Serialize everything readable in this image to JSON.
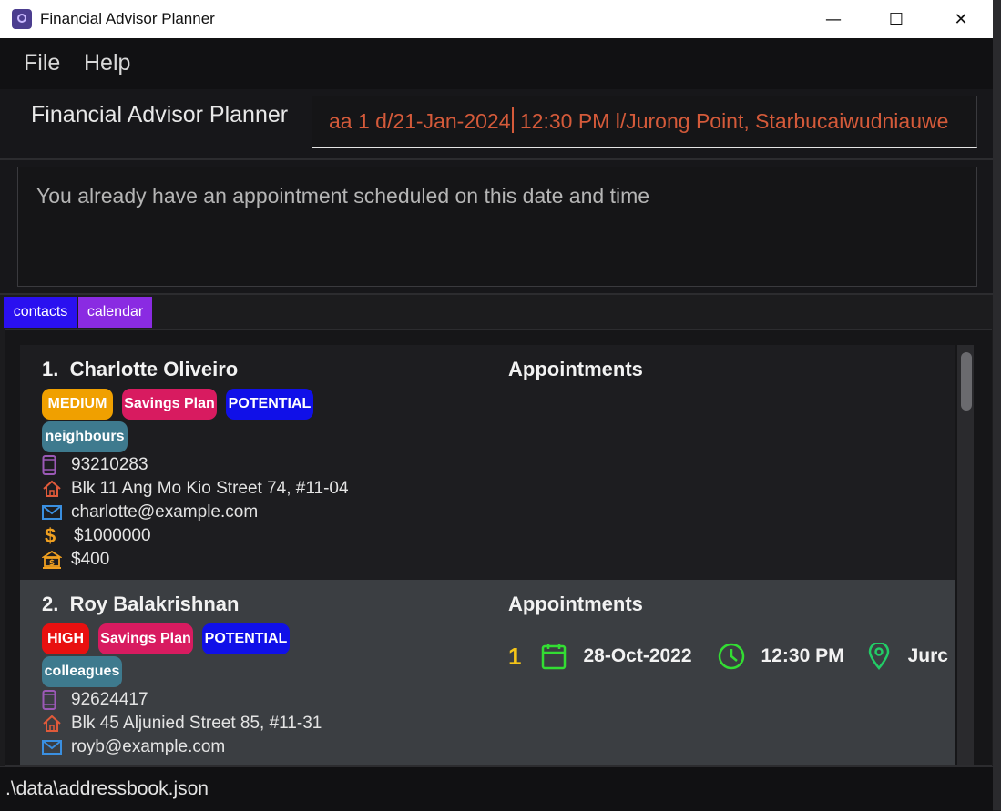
{
  "window": {
    "title": "Financial Advisor Planner",
    "minimize_glyph": "—",
    "maximize_glyph": "☐",
    "close_glyph": "✕"
  },
  "menu": {
    "items": [
      "File",
      "Help"
    ]
  },
  "command": {
    "app_label": "Financial Advisor Planner",
    "text_before_caret": "aa 1 d/21-Jan-2024",
    "text_after_caret": " 12:30 PM l/Jurong Point, Starbucaiwudniauwe"
  },
  "result": {
    "message": "You already have an appointment scheduled on this date and time"
  },
  "tabs": [
    {
      "label": "contacts",
      "color": "#2a10f0"
    },
    {
      "label": "calendar",
      "color": "#8a2be2"
    }
  ],
  "contacts": [
    {
      "index": "1.",
      "name": "Charlotte Oliveiro",
      "tags": [
        {
          "label": "MEDIUM",
          "color": "#f0a000"
        },
        {
          "label": "Savings Plan",
          "color": "#d81b60"
        },
        {
          "label": "POTENTIAL",
          "color": "#1010e8"
        },
        {
          "label": "neighbours",
          "color": "#3e7a8e"
        }
      ],
      "phone": "93210283",
      "address": "Blk 11 Ang Mo Kio Street 74, #11-04",
      "email": "charlotte@example.com",
      "income": "$1000000",
      "monthly": "$400",
      "appointments_heading": "Appointments",
      "appointments": []
    },
    {
      "index": "2.",
      "name": "Roy Balakrishnan",
      "tags": [
        {
          "label": "HIGH",
          "color": "#e81010"
        },
        {
          "label": "Savings Plan",
          "color": "#d81b60"
        },
        {
          "label": "POTENTIAL",
          "color": "#1010e8"
        },
        {
          "label": "colleagues",
          "color": "#3e7a8e"
        }
      ],
      "phone": "92624417",
      "address": "Blk 45 Aljunied Street 85, #11-31",
      "email": "royb@example.com",
      "appointments_heading": "Appointments",
      "appointments": [
        {
          "index": "1",
          "date": "28-Oct-2022",
          "time": "12:30 PM",
          "location": "Jurc"
        }
      ]
    }
  ],
  "status": {
    "path": ".\\data\\addressbook.json"
  },
  "icons": {
    "phone": "phone-icon",
    "address": "home-icon",
    "email": "mail-icon",
    "income": "dollar-icon",
    "monthly": "bank-icon",
    "date": "calendar-icon",
    "time": "clock-icon",
    "location": "location-pin-icon"
  },
  "colors": {
    "phone_icon": "#9b59b6",
    "home_icon": "#e05a3a",
    "mail_icon": "#3a8fe0",
    "dollar_icon": "#f0a020",
    "bank_icon": "#f0a020",
    "appt_icon": "#33dd33",
    "appt_index": "#f5c518",
    "location_icon": "#22cc66"
  }
}
